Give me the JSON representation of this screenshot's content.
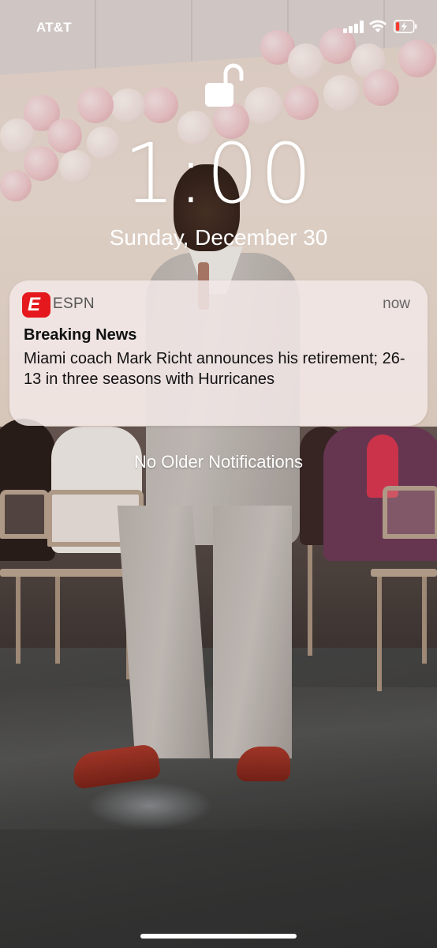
{
  "status_bar": {
    "carrier": "AT&T",
    "signal_bars": 4,
    "wifi_icon": "wifi-icon",
    "battery_icon": "battery-charging-icon",
    "battery_level": 0.2
  },
  "lock_screen": {
    "lock_icon": "unlocked-padlock-icon",
    "time": "1:00",
    "date": "Sunday, December 30"
  },
  "notification": {
    "app_icon": "espn-app-icon",
    "app_icon_glyph": "E",
    "app_name": "ESPN",
    "time": "now",
    "title": "Breaking News",
    "body": "Miami coach Mark Richt announces his retirement; 26-13 in three seasons with Hurricanes"
  },
  "footer_text": "No Older Notifications",
  "colors": {
    "espn_red": "#e5181d",
    "notification_bg": "#f2e8e6",
    "text_white": "#ffffff"
  }
}
